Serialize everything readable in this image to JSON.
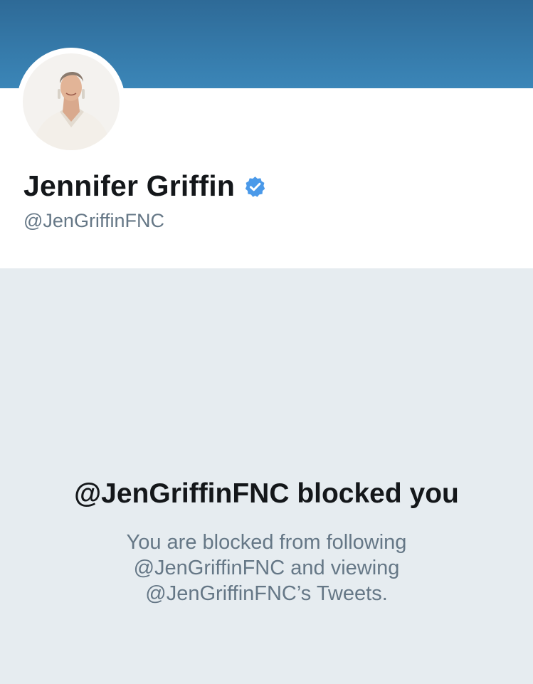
{
  "header": {
    "banner_color": "#3b86b8"
  },
  "profile": {
    "display_name": "Jennifer Griffin",
    "verified": true,
    "verified_icon": "verified-badge-icon",
    "verified_color": "#4a99e9",
    "handle": "@JenGriffinFNC"
  },
  "blocked": {
    "title": "@JenGriffinFNC blocked you",
    "message": "You are blocked from following @JenGriffinFNC and viewing @JenGriffinFNC’s Tweets."
  }
}
